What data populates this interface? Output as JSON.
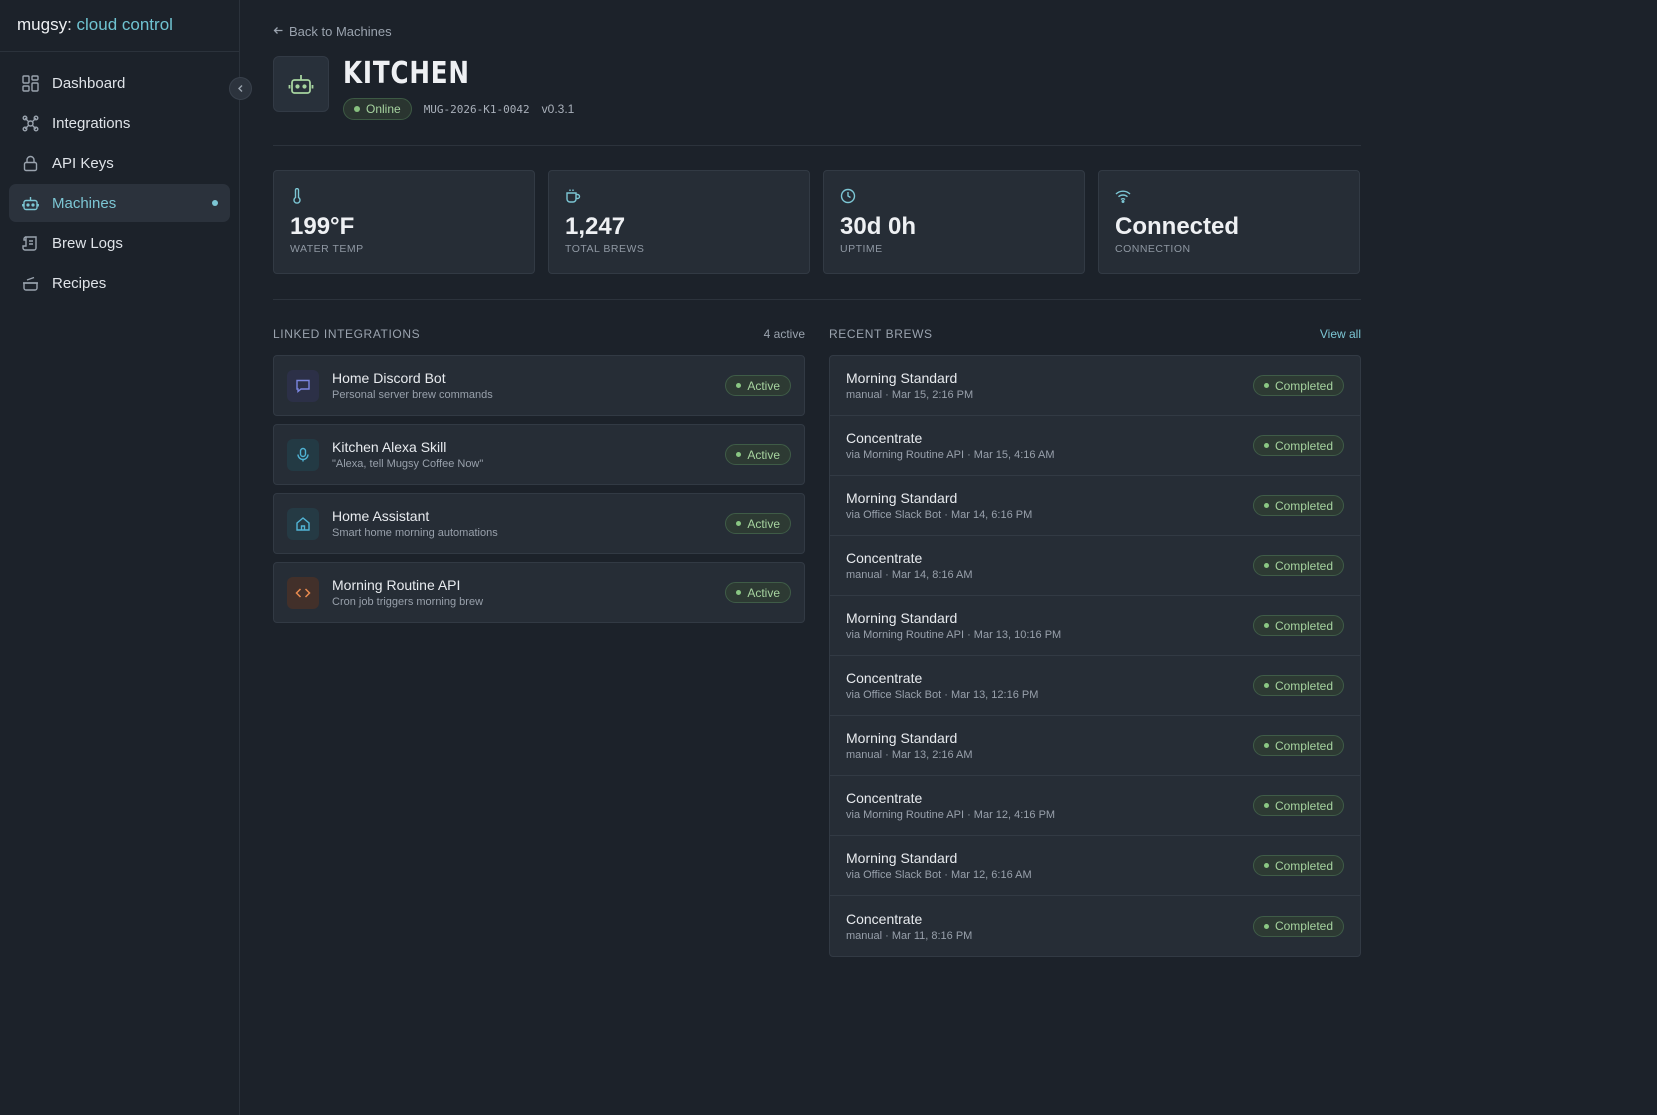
{
  "brand": {
    "prefix": "mugsy:",
    "accent": "cloud control"
  },
  "nav": [
    {
      "label": "Dashboard",
      "icon": "dashboard-icon"
    },
    {
      "label": "Integrations",
      "icon": "integrations-icon"
    },
    {
      "label": "API Keys",
      "icon": "lock-icon"
    },
    {
      "label": "Machines",
      "icon": "robot-icon",
      "active": true
    },
    {
      "label": "Brew Logs",
      "icon": "scroll-icon"
    },
    {
      "label": "Recipes",
      "icon": "pot-icon"
    }
  ],
  "back_label": "Back to Machines",
  "machine": {
    "name": "KITCHEN",
    "status": "Online",
    "serial": "MUG-2026-K1-0042",
    "version": "v0.3.1"
  },
  "stats": [
    {
      "value": "199°F",
      "label": "WATER TEMP",
      "icon": "thermometer-icon"
    },
    {
      "value": "1,247",
      "label": "TOTAL BREWS",
      "icon": "coffee-cup-icon"
    },
    {
      "value": "30d 0h",
      "label": "UPTIME",
      "icon": "clock-icon"
    },
    {
      "value": "Connected",
      "label": "CONNECTION",
      "icon": "wifi-icon"
    }
  ],
  "integrations": {
    "title": "LINKED INTEGRATIONS",
    "count": "4 active",
    "items": [
      {
        "name": "Home Discord Bot",
        "desc": "Personal server brew commands",
        "status": "Active",
        "icon": "chat-icon"
      },
      {
        "name": "Kitchen Alexa Skill",
        "desc": "\"Alexa, tell Mugsy Coffee Now\"",
        "status": "Active",
        "icon": "microphone-icon"
      },
      {
        "name": "Home Assistant",
        "desc": "Smart home morning automations",
        "status": "Active",
        "icon": "home-icon"
      },
      {
        "name": "Morning Routine API",
        "desc": "Cron job triggers morning brew",
        "status": "Active",
        "icon": "code-icon"
      }
    ]
  },
  "brews": {
    "title": "RECENT BREWS",
    "link": "View all",
    "items": [
      {
        "name": "Morning Standard",
        "meta": "manual · Mar 15, 2:16 PM",
        "status": "Completed"
      },
      {
        "name": "Concentrate",
        "meta": "via Morning Routine API · Mar 15, 4:16 AM",
        "status": "Completed"
      },
      {
        "name": "Morning Standard",
        "meta": "via Office Slack Bot · Mar 14, 6:16 PM",
        "status": "Completed"
      },
      {
        "name": "Concentrate",
        "meta": "manual · Mar 14, 8:16 AM",
        "status": "Completed"
      },
      {
        "name": "Morning Standard",
        "meta": "via Morning Routine API · Mar 13, 10:16 PM",
        "status": "Completed"
      },
      {
        "name": "Concentrate",
        "meta": "via Office Slack Bot · Mar 13, 12:16 PM",
        "status": "Completed"
      },
      {
        "name": "Morning Standard",
        "meta": "manual · Mar 13, 2:16 AM",
        "status": "Completed"
      },
      {
        "name": "Concentrate",
        "meta": "via Morning Routine API · Mar 12, 4:16 PM",
        "status": "Completed"
      },
      {
        "name": "Morning Standard",
        "meta": "via Office Slack Bot · Mar 12, 6:16 AM",
        "status": "Completed"
      },
      {
        "name": "Concentrate",
        "meta": "manual · Mar 11, 8:16 PM",
        "status": "Completed"
      }
    ]
  },
  "colors": {
    "accent": "#7cc6d4",
    "success": "#a6d39f",
    "background": "#1c222a",
    "card": "#262d36"
  }
}
